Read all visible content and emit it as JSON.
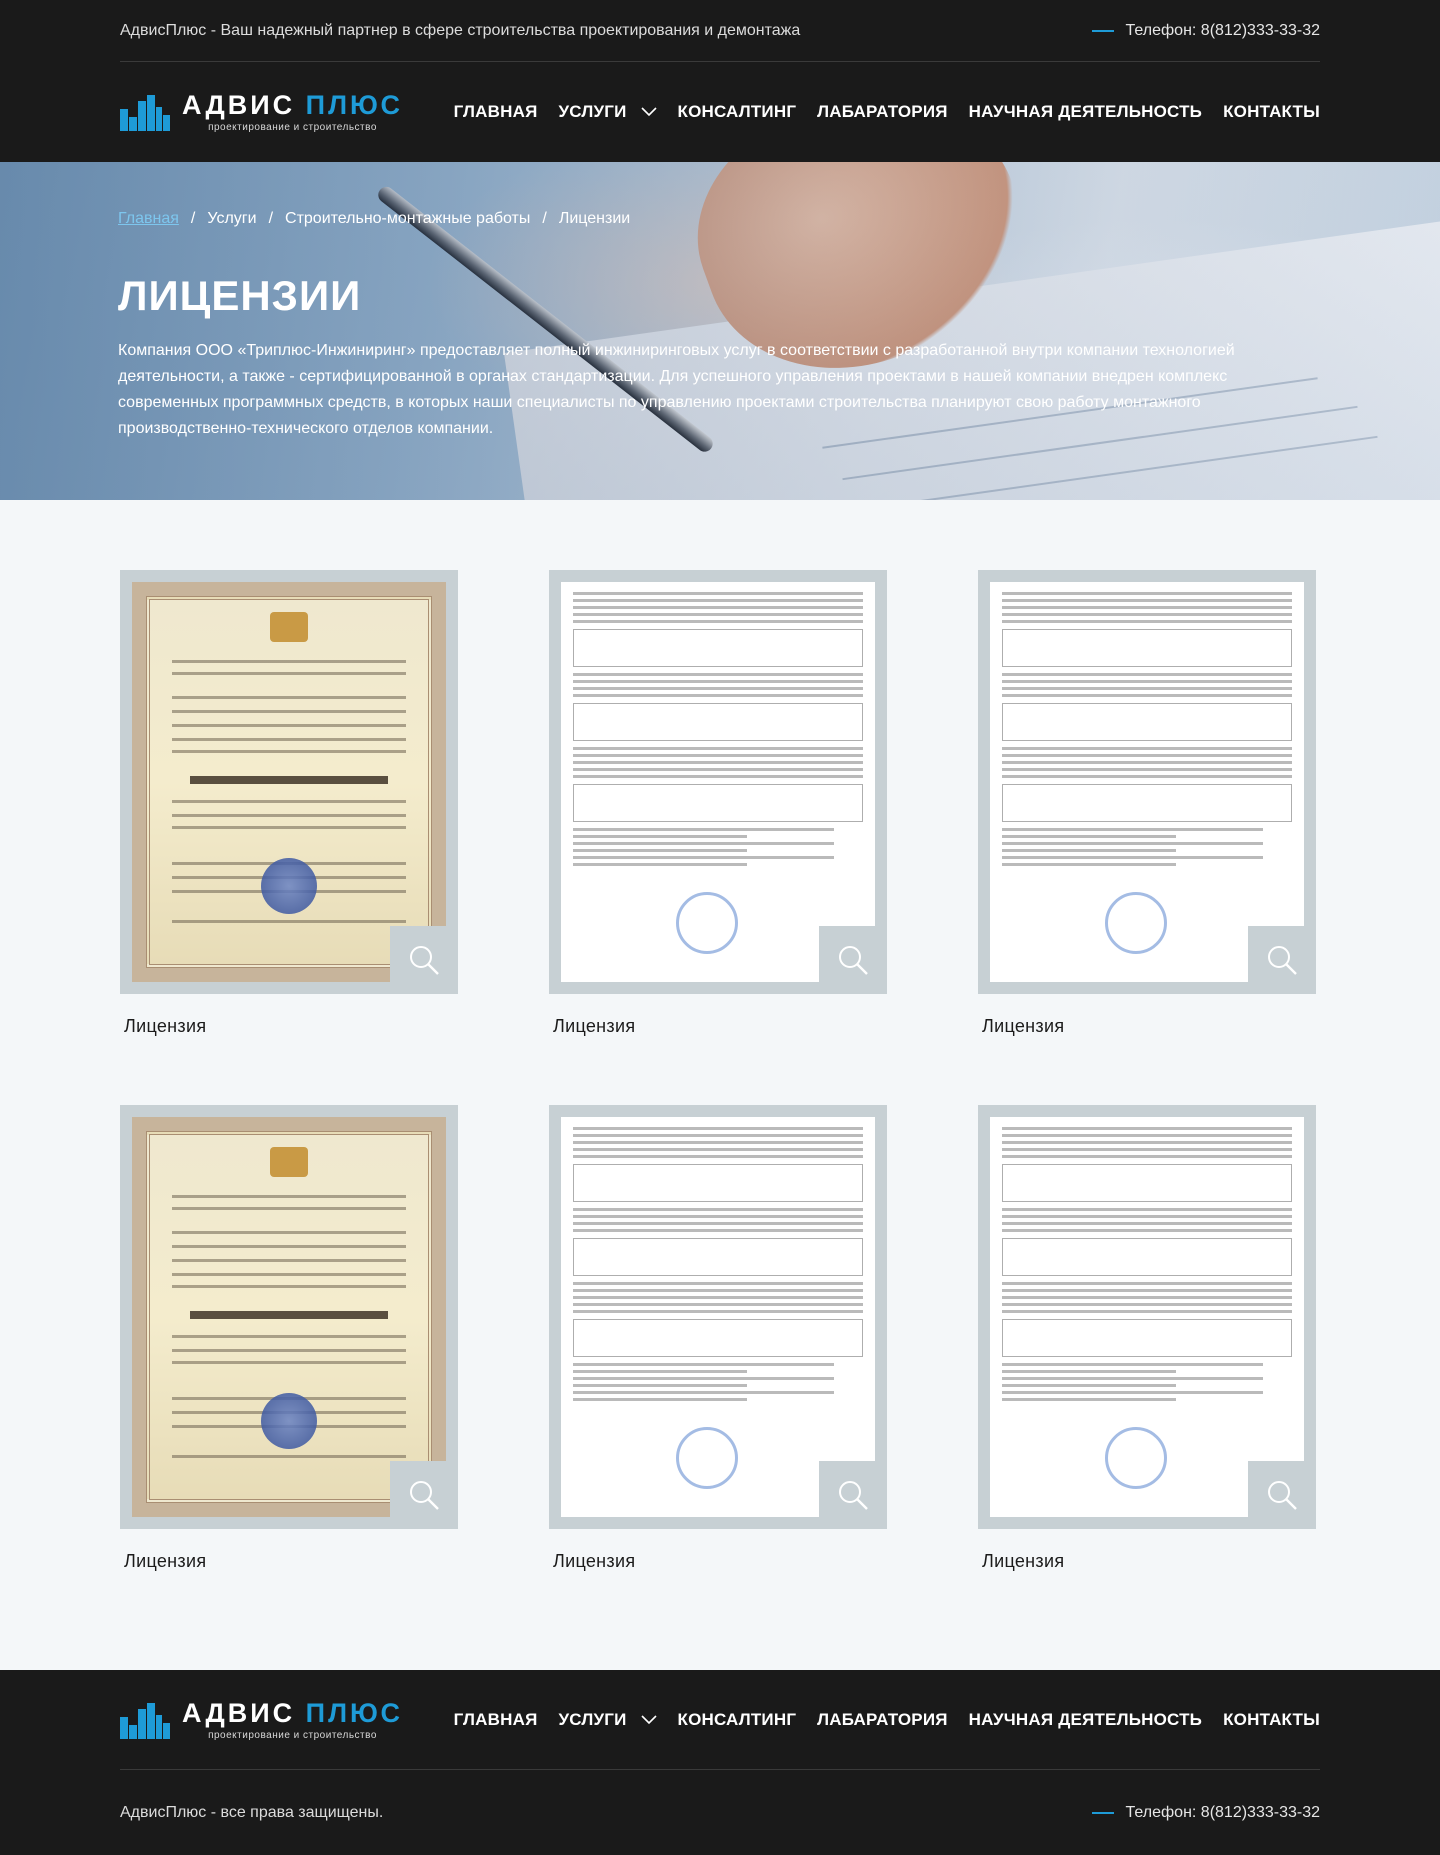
{
  "header": {
    "tagline": "АдвисПлюс - Ваш надежный партнер в сфере строительства проектирования и демонтажа",
    "phone": "Телефон: 8(812)333-33-32"
  },
  "logo": {
    "name_part1": "АДВИС",
    "name_part2": "ПЛЮС",
    "subtitle": "проектирование и строительство"
  },
  "nav": {
    "items": [
      {
        "label": "ГЛАВНАЯ"
      },
      {
        "label": "УСЛУГИ",
        "has_dropdown": true
      },
      {
        "label": "КОНСАЛТИНГ"
      },
      {
        "label": "ЛАБАРАТОРИЯ"
      },
      {
        "label": "НАУЧНАЯ ДЕЯТЕЛЬНОСТЬ"
      },
      {
        "label": "КОНТАКТЫ"
      }
    ]
  },
  "breadcrumb": {
    "items": [
      "Главная",
      "Услуги",
      "Строительно-монтажные работы",
      "Лицензии"
    ],
    "separator": "/"
  },
  "hero": {
    "title": "ЛИЦЕНЗИИ",
    "text": "Компания ООО «Триплюс-Инжиниринг» предоставляет полный инжиниринговых услуг в соответствии с разработанной внутри компании технологией деятельности, а также - сертифицированной в органах стандартизации. Для успешного управления проектами в нашей компании внедрен комплекс современных программных средств, в которых наши специалисты по управлению проектами строительства планируют свою работу монтажного производственно-технического отделов компании."
  },
  "gallery": {
    "items": [
      {
        "label": "Лицензия",
        "doc_type": "certificate"
      },
      {
        "label": "Лицензия",
        "doc_type": "form"
      },
      {
        "label": "Лицензия",
        "doc_type": "form"
      },
      {
        "label": "Лицензия",
        "doc_type": "certificate"
      },
      {
        "label": "Лицензия",
        "doc_type": "form"
      },
      {
        "label": "Лицензия",
        "doc_type": "form"
      }
    ]
  },
  "footer": {
    "copyright": "АдвисПлюс - все права защищены.",
    "phone": "Телефон: 8(812)333-33-32"
  },
  "colors": {
    "dark_bg": "#1a1a1a",
    "accent": "#1e9bd7",
    "page_bg": "#f4f7f9",
    "frame": "#c7d0d4"
  }
}
